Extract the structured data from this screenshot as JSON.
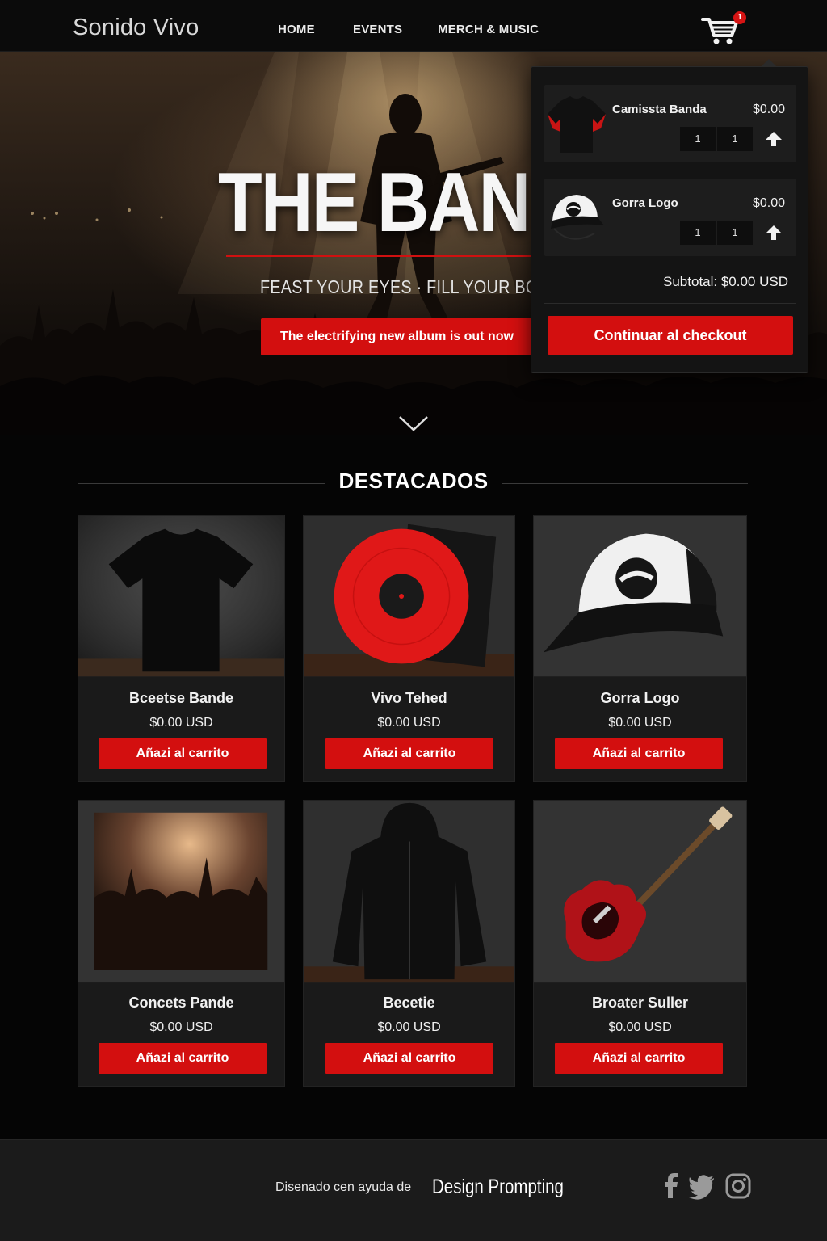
{
  "nav": {
    "logo": "Sonido Vivo",
    "links": [
      "HOME",
      "EVENTS",
      "MERCH & MUSIC"
    ],
    "cart_count": "1"
  },
  "hero": {
    "title": "THE BAN",
    "tagline": "FEAST YOUR EYES · FILL YOUR BOOT",
    "cta": "The electrifying new album is out now"
  },
  "cart": {
    "items": [
      {
        "name": "Camissta Banda",
        "price": "$0.00",
        "qty_a": "1",
        "qty_b": "1"
      },
      {
        "name": "Gorra Logo",
        "price": "$0.00",
        "qty_a": "1",
        "qty_b": "1"
      }
    ],
    "subtotal": "Subtotal: $0.00 USD",
    "checkout": "Continuar al checkout"
  },
  "featured": {
    "title": "DESTACADOS",
    "products": [
      {
        "name": "Bceetse Bande",
        "price": "$0.00 USD",
        "button": "Añazi al carrito"
      },
      {
        "name": "Vivo Tehed",
        "price": "$0.00 USD",
        "button": "Añazi al carrito"
      },
      {
        "name": "Gorra Logo",
        "price": "$0.00 USD",
        "button": "Añazi al carrito"
      },
      {
        "name": "Concets Pande",
        "price": "$0.00 USD",
        "button": "Añazi al carrito"
      },
      {
        "name": "Becetie",
        "price": "$0.00 USD",
        "button": "Añazi al carrito"
      },
      {
        "name": "Broater Suller",
        "price": "$0.00 USD",
        "button": "Añazi al carrito"
      }
    ]
  },
  "footer": {
    "text": "Disenado cen ayuda de",
    "brand": "Design Prompting",
    "social": [
      "facebook-icon",
      "twitter-icon",
      "instagram-icon"
    ]
  },
  "colors": {
    "accent": "#d30f0f",
    "background": "#050505",
    "card": "#1a1a1a",
    "footer": "#1b1b1b"
  }
}
